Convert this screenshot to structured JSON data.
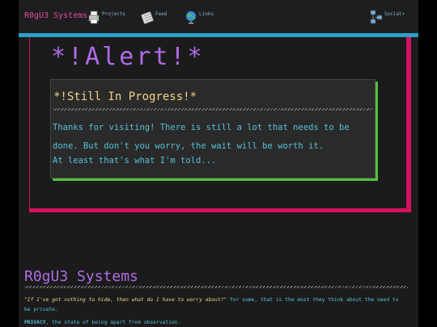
{
  "nav": {
    "brand": "R0gU3 Systems",
    "items": [
      {
        "label": "Projects",
        "icon": "printer-icon"
      },
      {
        "label": "Feed",
        "icon": "feed-icon"
      },
      {
        "label": "Links",
        "icon": "globe-icon"
      }
    ],
    "social_label": "Social▾"
  },
  "alert": {
    "title": "*!Alert!*",
    "box_title": "*!Still In Progress!*",
    "text": "Thanks for visiting! There is still a lot that needs to be done. But don't you worry, the wait will be worth it.",
    "text2": "At least that's what I'm told..."
  },
  "footer": {
    "title": "R0gU3 Systems",
    "quote": "\"If I've got nothing to hide, then what do I have to worry about?\"",
    "quote_rest": " for some, that is the most they think about the need to be private.",
    "privacy_term": "PRIVACY",
    "privacy_def": ", the state of being apart from observation."
  },
  "colors": {
    "accent_blue": "#2a9fc9",
    "accent_pink": "#d4125d",
    "accent_green": "#54c23a",
    "title_purple": "#b06be6"
  }
}
